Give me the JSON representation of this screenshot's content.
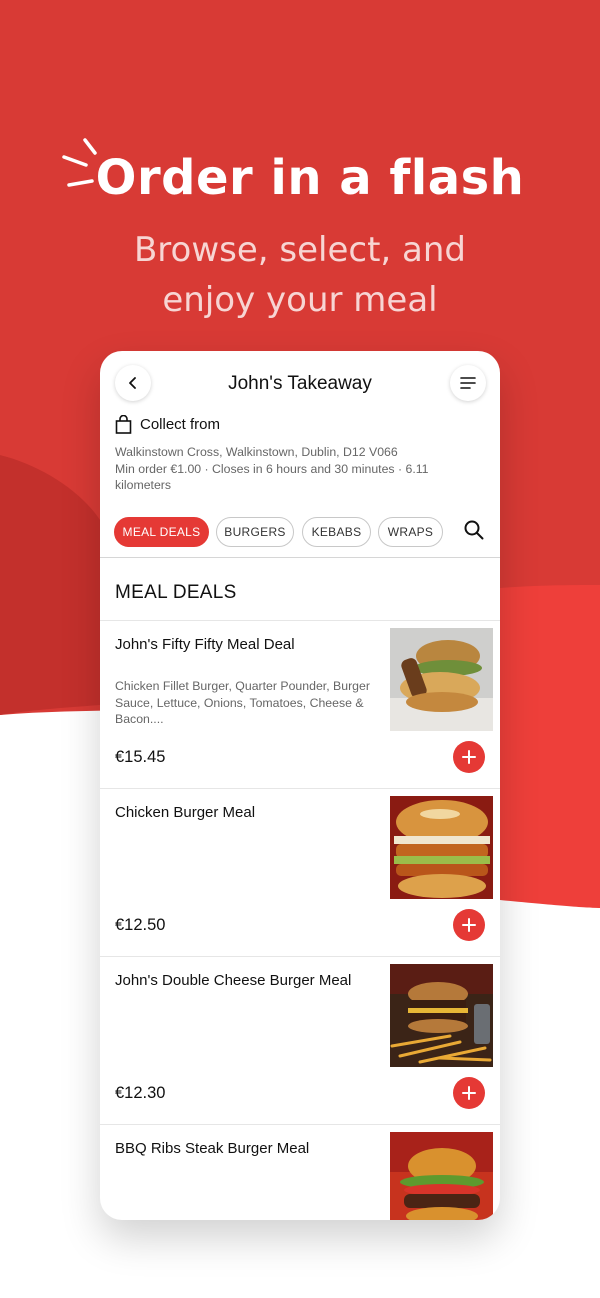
{
  "promo": {
    "headline": "Order in a flash",
    "subline1": "Browse, select, and",
    "subline2": "enjoy your meal"
  },
  "header": {
    "title": "John's Takeaway",
    "back_icon": "chevron-left-icon",
    "menu_icon": "menu-icon"
  },
  "store": {
    "collect_label": "Collect from",
    "collect_icon": "shopping-bag-icon",
    "address": "Walkinstown Cross, Walkinstown,  Dublin, D12 V066",
    "details": "Min order €1.00 · Closes in 6 hours and 30 minutes · 6.11 kilometers"
  },
  "categories": [
    {
      "label": "MEAL DEALS",
      "active": true
    },
    {
      "label": "BURGERS",
      "active": false
    },
    {
      "label": "KEBABS",
      "active": false
    },
    {
      "label": "WRAPS",
      "active": false
    }
  ],
  "section_title": "MEAL DEALS",
  "items": [
    {
      "name": "John's Fifty Fifty Meal Deal",
      "description": "Chicken Fillet Burger, Quarter Pounder, Burger Sauce, Lettuce, Onions, Tomatoes, Cheese & Bacon....",
      "price": "€15.45"
    },
    {
      "name": "Chicken Burger Meal",
      "description": "",
      "price": "€12.50"
    },
    {
      "name": "John's Double Cheese Burger Meal",
      "description": "",
      "price": "€12.30"
    },
    {
      "name": "BBQ Ribs Steak Burger Meal",
      "description": "",
      "price": ""
    }
  ],
  "colors": {
    "brand_red": "#d83a35",
    "accent_red": "#e53935",
    "dark_red": "#c3302c"
  }
}
